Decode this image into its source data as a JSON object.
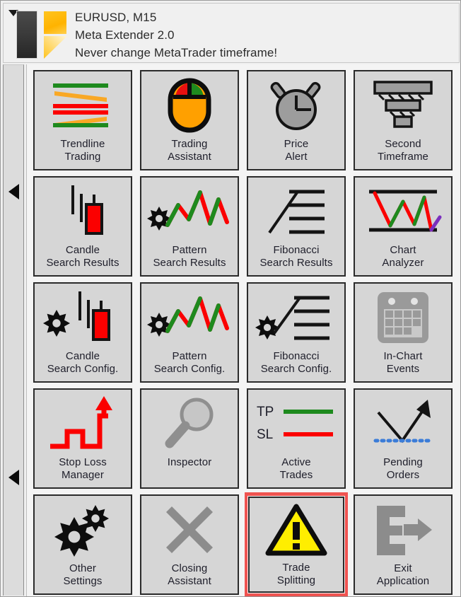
{
  "window": {
    "header": {
      "dropdown_icon": "chevron-down-icon",
      "logo_icon": "meta-extender-logo",
      "lines": [
        "EURUSD, M15",
        "Meta Extender 2.0",
        "Never change MetaTrader timeframe!"
      ]
    },
    "sidebar": {
      "arrows": [
        {
          "icon": "triangle-left-icon"
        },
        {
          "icon": "triangle-left-icon"
        }
      ]
    }
  },
  "colors": {
    "window_bg": "#f0f0f0",
    "panel_bg": "#f4f4f4",
    "button_face": "#d6d6d6",
    "button_border": "#2b2b2b",
    "rail_bg": "#dcdcdc",
    "text": "#20202c",
    "highlight": "#ef5350",
    "accent_green": "#1e8a1e",
    "accent_red": "#fb0000",
    "accent_orange": "#f9a825",
    "accent_yellow": "#ffee00",
    "accent_gray": "#8c8c8c",
    "accent_purple": "#7b2fbe",
    "accent_blue": "#3b7cd8"
  },
  "grid": {
    "columns": 4,
    "rows": 5,
    "buttons": [
      {
        "id": "trendline-trading",
        "label": "Trendline\nTrading",
        "icon": "trendline-icon",
        "highlighted": false
      },
      {
        "id": "trading-assistant",
        "label": "Trading\nAssistant",
        "icon": "mouse-icon",
        "highlighted": false
      },
      {
        "id": "price-alert",
        "label": "Price\nAlert",
        "icon": "alarm-clock-icon",
        "highlighted": false
      },
      {
        "id": "second-timeframe",
        "label": "Second\nTimeframe",
        "icon": "funnel-stack-icon",
        "highlighted": false
      },
      {
        "id": "candle-search-results",
        "label": "Candle\nSearch Results",
        "icon": "candlestick-icon",
        "highlighted": false
      },
      {
        "id": "pattern-search-results",
        "label": "Pattern\nSearch Results",
        "icon": "zigzag-gear-icon",
        "highlighted": false
      },
      {
        "id": "fibonacci-search-results",
        "label": "Fibonacci\nSearch Results",
        "icon": "fibonacci-icon",
        "highlighted": false
      },
      {
        "id": "chart-analyzer",
        "label": "Chart\nAnalyzer",
        "icon": "chart-analyzer-icon",
        "highlighted": false
      },
      {
        "id": "candle-search-config",
        "label": "Candle\nSearch Config.",
        "icon": "candlestick-gear-icon",
        "highlighted": false
      },
      {
        "id": "pattern-search-config",
        "label": "Pattern\nSearch Config.",
        "icon": "zigzag-gear-icon",
        "highlighted": false
      },
      {
        "id": "fibonacci-search-config",
        "label": "Fibonacci\nSearch Config.",
        "icon": "fibonacci-gear-icon",
        "highlighted": false
      },
      {
        "id": "in-chart-events",
        "label": "In-Chart\nEvents",
        "icon": "calendar-icon",
        "highlighted": false
      },
      {
        "id": "stop-loss-manager",
        "label": "Stop Loss\nManager",
        "icon": "staircase-arrow-icon",
        "highlighted": false
      },
      {
        "id": "inspector",
        "label": "Inspector",
        "icon": "magnifier-icon",
        "highlighted": false
      },
      {
        "id": "active-trades",
        "label": "Active\nTrades",
        "icon": "tp-sl-lines-icon",
        "highlighted": false
      },
      {
        "id": "pending-orders",
        "label": "Pending\nOrders",
        "icon": "pending-arrow-icon",
        "highlighted": false
      },
      {
        "id": "other-settings",
        "label": "Other\nSettings",
        "icon": "gears-icon",
        "highlighted": false
      },
      {
        "id": "closing-assistant",
        "label": "Closing\nAssistant",
        "icon": "cross-icon",
        "highlighted": false
      },
      {
        "id": "trade-splitting",
        "label": "Trade\nSplitting",
        "icon": "warning-triangle-icon",
        "highlighted": true
      },
      {
        "id": "exit-application",
        "label": "Exit\nApplication",
        "icon": "exit-arrow-icon",
        "highlighted": false
      }
    ],
    "icon_labels": {
      "tp": "TP",
      "sl": "SL"
    }
  }
}
